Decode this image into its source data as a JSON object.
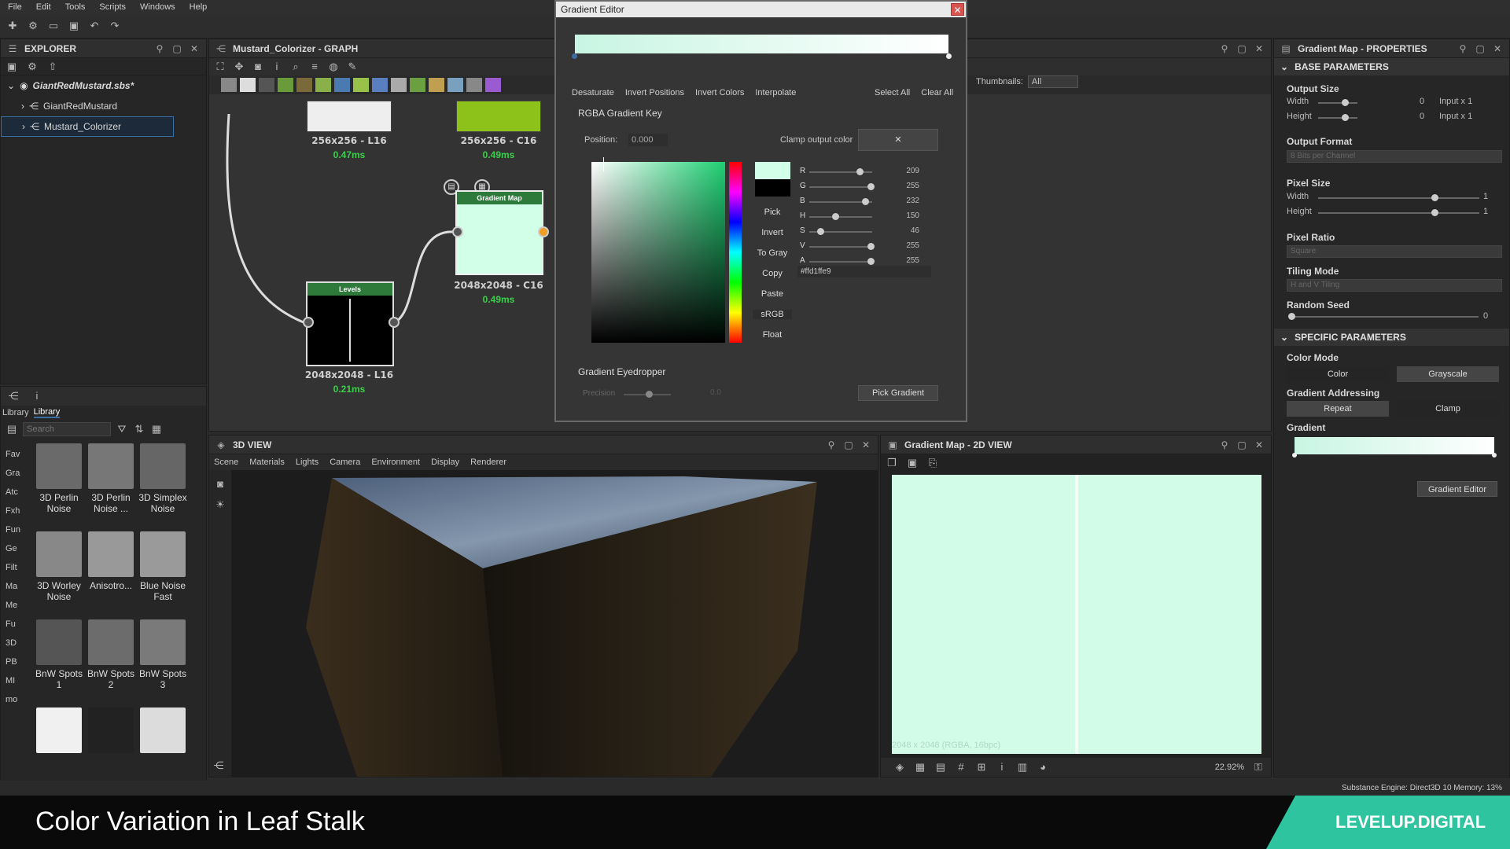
{
  "menu": [
    "File",
    "Edit",
    "Tools",
    "Scripts",
    "Windows",
    "Help"
  ],
  "explorer": {
    "title": "EXPLORER",
    "package": "GiantRedMustard.sbs*",
    "items": [
      "GiantRedMustard",
      "Mustard_Colorizer"
    ]
  },
  "graph": {
    "title": "Mustard_Colorizer - GRAPH",
    "thumbnails_label": "Thumbnails:",
    "thumbnails_value": "All",
    "nodes": [
      {
        "size": "256x256 - L16",
        "time": "0.47ms"
      },
      {
        "size": "256x256 - C16",
        "time": "0.49ms"
      },
      {
        "title": "Gradient Map",
        "size": "2048x2048 - C16",
        "time": "0.49ms"
      },
      {
        "title": "Levels",
        "size": "2048x2048 - L16",
        "time": "0.21ms"
      }
    ]
  },
  "gradient_editor": {
    "title": "Gradient Editor",
    "actions": [
      "Desaturate",
      "Invert Positions",
      "Invert Colors",
      "Interpolate"
    ],
    "select_all": "Select All",
    "clear_all": "Clear All",
    "key_title": "RGBA Gradient Key",
    "position_label": "Position:",
    "position_value": "0.000",
    "clamp_label": "Clamp output color",
    "clamp_value": "✕",
    "side_buttons": [
      "Pick",
      "Invert",
      "To Gray",
      "Copy",
      "Paste",
      "sRGB",
      "Float"
    ],
    "channels": [
      {
        "label": "R",
        "value": "209",
        "frac": 0.82
      },
      {
        "label": "G",
        "value": "255",
        "frac": 1.0
      },
      {
        "label": "B",
        "value": "232",
        "frac": 0.91
      },
      {
        "label": "H",
        "value": "150",
        "frac": 0.42
      },
      {
        "label": "S",
        "value": "46",
        "frac": 0.18
      },
      {
        "label": "V",
        "value": "255",
        "frac": 1.0
      },
      {
        "label": "A",
        "value": "255",
        "frac": 1.0
      }
    ],
    "hex": "#ffd1ffe9",
    "eyedropper_title": "Gradient Eyedropper",
    "precision_label": "Precision",
    "precision_value": "0.0",
    "pick_gradient": "Pick Gradient",
    "colors": {
      "key": "#d1ffe8",
      "gradient_start": "#c8f5e3",
      "gradient_end": "#ffffff"
    }
  },
  "library": {
    "tabs": [
      "Library",
      "Library"
    ],
    "search_placeholder": "Search",
    "side": [
      "Fav",
      "Gra",
      "Atc",
      "Fxh",
      "Fun",
      "Ge",
      "Filt",
      "Ma",
      "Me",
      "Fu",
      "3D",
      "PB",
      "MI",
      "mo"
    ],
    "items": [
      {
        "label": "3D Perlin Noise"
      },
      {
        "label": "3D Perlin Noise ..."
      },
      {
        "label": "3D Simplex Noise"
      },
      {
        "label": "3D Worley Noise"
      },
      {
        "label": "Anisotro..."
      },
      {
        "label": "Blue Noise Fast"
      },
      {
        "label": "BnW Spots 1"
      },
      {
        "label": "BnW Spots 2"
      },
      {
        "label": "BnW Spots 3"
      },
      {
        "label": ""
      },
      {
        "label": ""
      },
      {
        "label": ""
      }
    ]
  },
  "view3d": {
    "title": "3D VIEW",
    "menu": [
      "Scene",
      "Materials",
      "Lights",
      "Camera",
      "Environment",
      "Display",
      "Renderer"
    ]
  },
  "view2d": {
    "title": "Gradient Map - 2D VIEW",
    "info": "2048 x 2048 (RGBA, 16bpc)",
    "zoom": "22.92%"
  },
  "properties": {
    "title": "Gradient Map - PROPERTIES",
    "base": "BASE PARAMETERS",
    "output_size": {
      "label": "Output Size",
      "width": "Width",
      "height": "Height",
      "w_val": "0",
      "h_val": "0",
      "w_mode": "Input x 1",
      "h_mode": "Input x 1"
    },
    "output_format": {
      "label": "Output Format",
      "value": "8 Bits per Channel"
    },
    "pixel_size": {
      "label": "Pixel Size",
      "width": "Width",
      "height": "Height",
      "w_val": "1",
      "h_val": "1"
    },
    "pixel_ratio": {
      "label": "Pixel Ratio",
      "value": "Square"
    },
    "tiling_mode": {
      "label": "Tiling Mode",
      "value": "H and V Tiling"
    },
    "random_seed": {
      "label": "Random Seed",
      "value": "0"
    },
    "specific": "SPECIFIC PARAMETERS",
    "color_mode": {
      "label": "Color Mode",
      "options": [
        "Color",
        "Grayscale"
      ]
    },
    "gradient_addressing": {
      "label": "Gradient Addressing",
      "options": [
        "Repeat",
        "Clamp"
      ]
    },
    "gradient_label": "Gradient",
    "gradient_editor_btn": "Gradient Editor"
  },
  "status": {
    "text": "Substance Engine: Direct3D 10  Memory: 13%"
  },
  "caption": {
    "text": "Color Variation in Leaf Stalk",
    "brand": "LEVELUP.DIGITAL"
  }
}
